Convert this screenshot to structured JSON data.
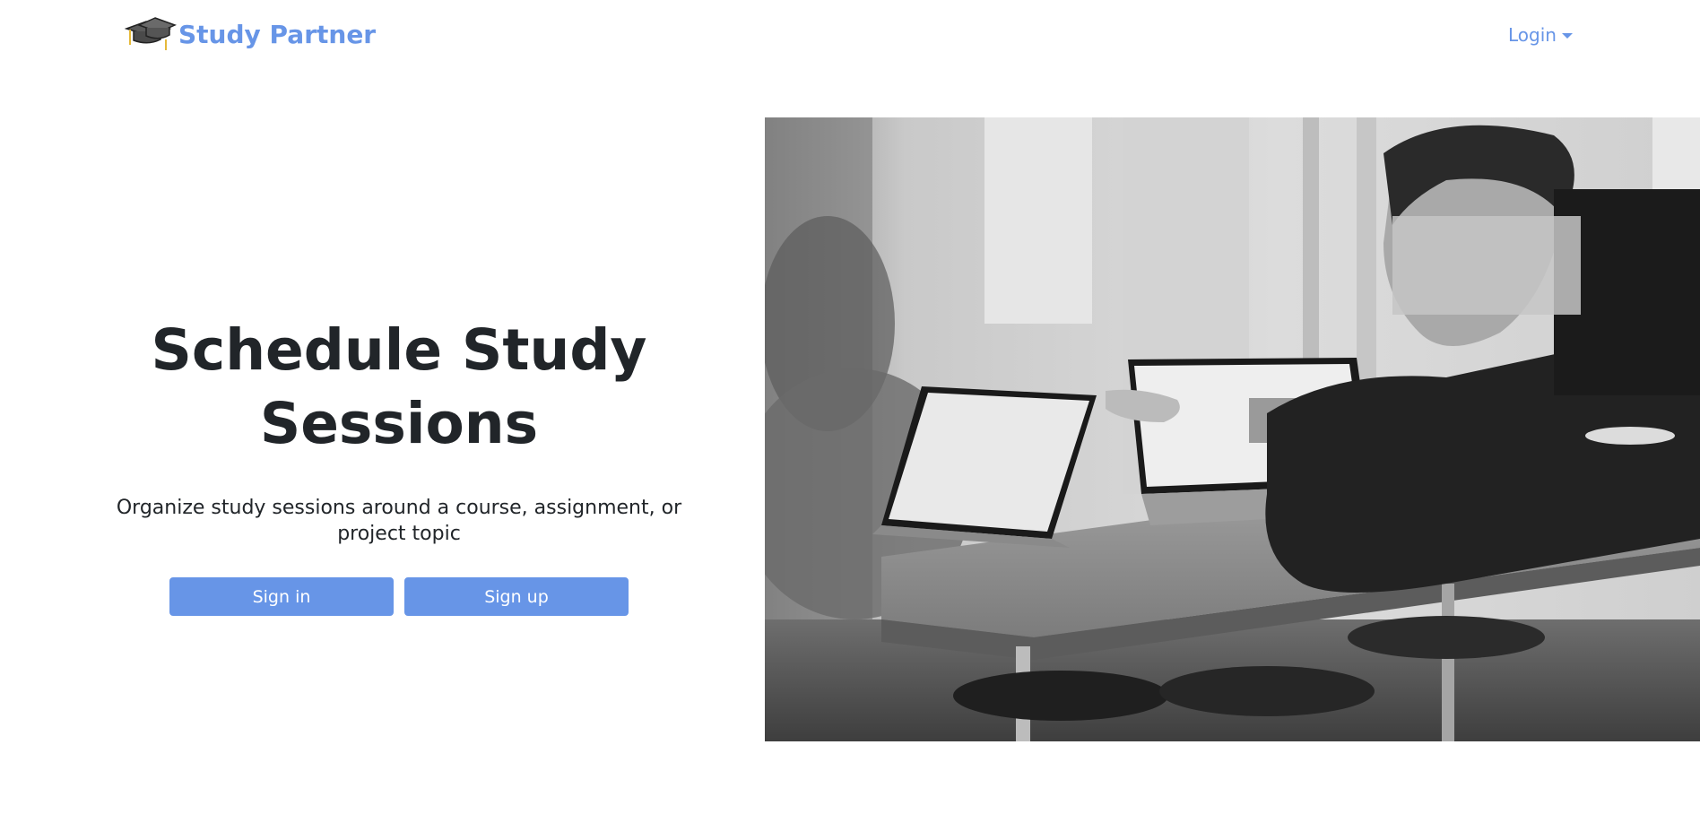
{
  "navbar": {
    "brand_name": "Study Partner",
    "brand_icon": "graduation-cap-icon",
    "login_label": "Login",
    "login_icon": "caret-down-icon"
  },
  "hero": {
    "title": "Schedule Study Sessions",
    "subtitle": "Organize study sessions around a course, assignment, or project topic",
    "sign_in_label": "Sign in",
    "sign_up_label": "Sign up",
    "image": "black-and-white photo of people working on laptops at a table"
  },
  "colors": {
    "accent": "#6795e7",
    "text": "#212529",
    "background": "#ffffff"
  }
}
